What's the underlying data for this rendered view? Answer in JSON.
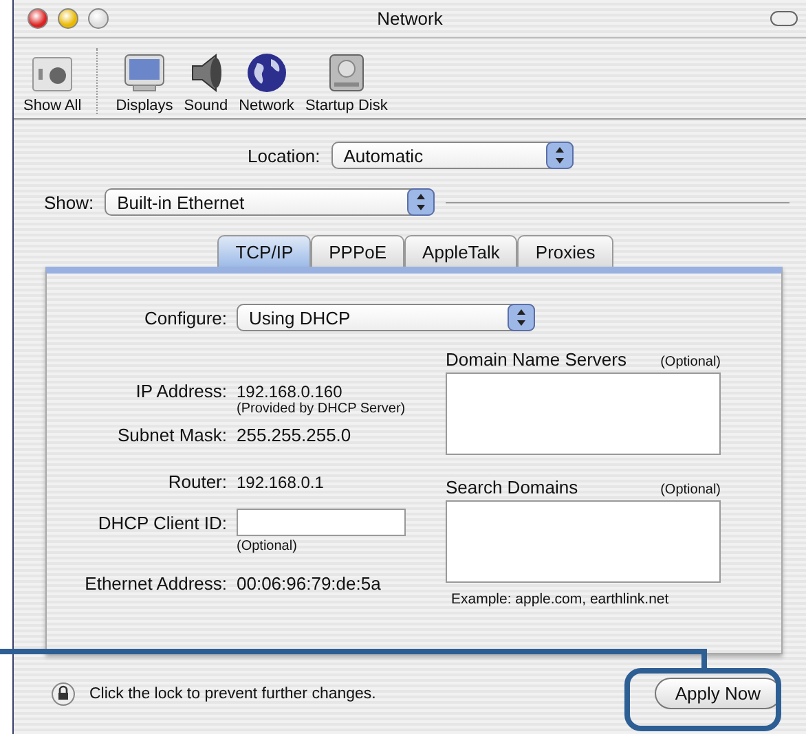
{
  "window": {
    "title": "Network"
  },
  "toolbar": [
    {
      "kind": "showall",
      "label": "Show All"
    },
    {
      "kind": "displays",
      "label": "Displays"
    },
    {
      "kind": "sound",
      "label": "Sound"
    },
    {
      "kind": "network",
      "label": "Network"
    },
    {
      "kind": "disk",
      "label": "Startup Disk"
    }
  ],
  "location": {
    "label": "Location:",
    "value": "Automatic"
  },
  "show": {
    "label": "Show:",
    "value": "Built-in Ethernet"
  },
  "tabs": [
    {
      "label": "TCP/IP",
      "selected": true
    },
    {
      "label": "PPPoE",
      "selected": false
    },
    {
      "label": "AppleTalk",
      "selected": false
    },
    {
      "label": "Proxies",
      "selected": false
    }
  ],
  "configure": {
    "label": "Configure:",
    "value": "Using DHCP"
  },
  "ip_address": {
    "label": "IP Address:",
    "value": "192.168.0.160",
    "note": "(Provided by DHCP Server)"
  },
  "subnet_mask": {
    "label": "Subnet Mask:",
    "value": "255.255.255.0"
  },
  "router": {
    "label": "Router:",
    "value": "192.168.0.1"
  },
  "dhcp_client_id": {
    "label": "DHCP Client ID:",
    "note": "(Optional)"
  },
  "ethernet_address": {
    "label": "Ethernet Address:",
    "value": "00:06:96:79:de:5a"
  },
  "domain_name_servers": {
    "title": "Domain Name Servers",
    "optional": "(Optional)"
  },
  "search_domains": {
    "title": "Search Domains",
    "optional": "(Optional)",
    "example": "Example: apple.com, earthlink.net"
  },
  "lock": {
    "text": "Click the lock to prevent further changes."
  },
  "apply_button": {
    "label": "Apply Now"
  }
}
